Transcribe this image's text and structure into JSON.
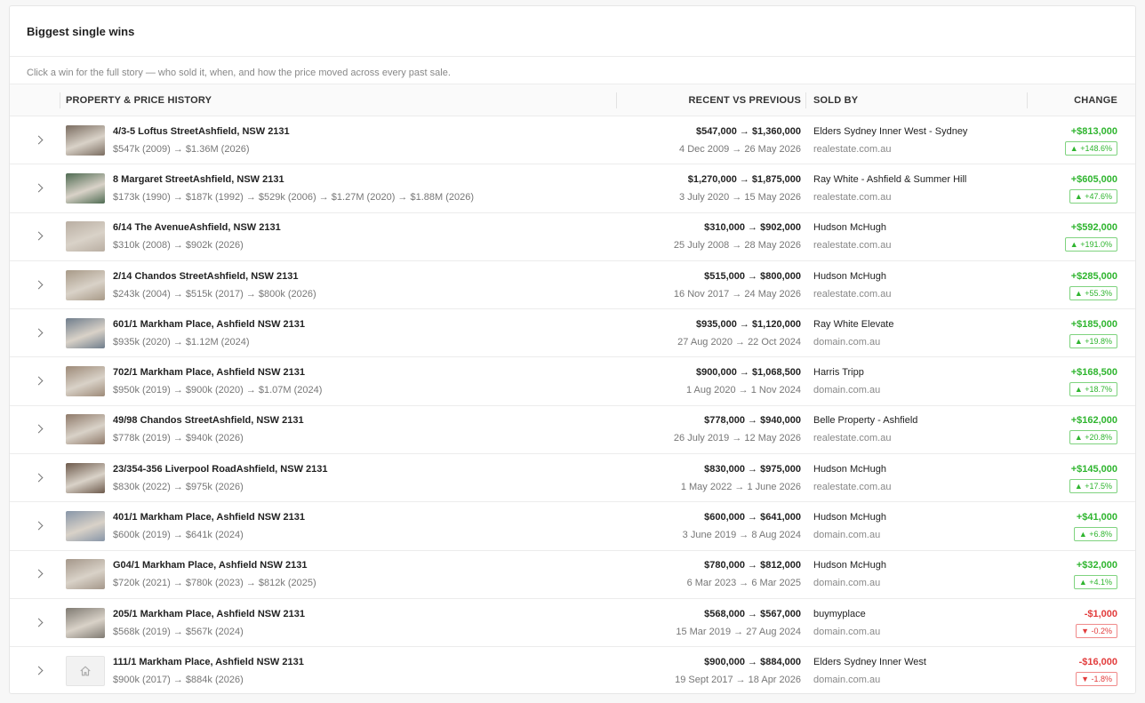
{
  "page": {
    "title": "Biggest single wins",
    "subtitle": "Click a win for the full story — who sold it, when, and how the price moved across every past sale."
  },
  "columns": {
    "property": "PROPERTY & PRICE HISTORY",
    "recent": "RECENT VS PREVIOUS",
    "sold_by": "SOLD BY",
    "change": "CHANGE"
  },
  "rows": [
    {
      "address": "4/3-5 Loftus StreetAshfield, NSW 2131",
      "history": "$547k (2009) → $1.36M (2026)",
      "prices": "$547,000 → $1,360,000",
      "dates": "4 Dec 2009 → 26 May 2026",
      "agent": "Elders Sydney Inner West - Sydney",
      "source": "realestate.com.au",
      "change": "+$813,000",
      "pct": "▲ +148.6%",
      "dir": "up",
      "thumb": "#7a6c60"
    },
    {
      "address": "8 Margaret StreetAshfield, NSW 2131",
      "history": "$173k (1990) → $187k (1992) → $529k (2006) → $1.27M (2020) → $1.88M (2026)",
      "prices": "$1,270,000 → $1,875,000",
      "dates": "3 July 2020 → 15 May 2026",
      "agent": "Ray White - Ashfield & Summer Hill",
      "source": "realestate.com.au",
      "change": "+$605,000",
      "pct": "▲ +47.6%",
      "dir": "up",
      "thumb": "#4f6b52"
    },
    {
      "address": "6/14 The AvenueAshfield, NSW 2131",
      "history": "$310k (2008) → $902k (2026)",
      "prices": "$310,000 → $902,000",
      "dates": "25 July 2008 → 28 May 2026",
      "agent": "Hudson McHugh",
      "source": "realestate.com.au",
      "change": "+$592,000",
      "pct": "▲ +191.0%",
      "dir": "up",
      "thumb": "#b9aea2"
    },
    {
      "address": "2/14 Chandos StreetAshfield, NSW 2131",
      "history": "$243k (2004) → $515k (2017) → $800k (2026)",
      "prices": "$515,000 → $800,000",
      "dates": "16 Nov 2017 → 24 May 2026",
      "agent": "Hudson McHugh",
      "source": "realestate.com.au",
      "change": "+$285,000",
      "pct": "▲ +55.3%",
      "dir": "up",
      "thumb": "#a89a88"
    },
    {
      "address": "601/1 Markham Place, Ashfield NSW 2131",
      "history": "$935k (2020) → $1.12M (2024)",
      "prices": "$935,000 → $1,120,000",
      "dates": "27 Aug 2020 → 22 Oct 2024",
      "agent": "Ray White Elevate",
      "source": "domain.com.au",
      "change": "+$185,000",
      "pct": "▲ +19.8%",
      "dir": "up",
      "thumb": "#6f7d8c"
    },
    {
      "address": "702/1 Markham Place, Ashfield NSW 2131",
      "history": "$950k (2019) → $900k (2020) → $1.07M (2024)",
      "prices": "$900,000 → $1,068,500",
      "dates": "1 Aug 2020 → 1 Nov 2024",
      "agent": "Harris Tripp",
      "source": "domain.com.au",
      "change": "+$168,500",
      "pct": "▲ +18.7%",
      "dir": "up",
      "thumb": "#9d8a78"
    },
    {
      "address": "49/98 Chandos StreetAshfield, NSW 2131",
      "history": "$778k (2019) → $940k (2026)",
      "prices": "$778,000 → $940,000",
      "dates": "26 July 2019 → 12 May 2026",
      "agent": "Belle Property - Ashfield",
      "source": "realestate.com.au",
      "change": "+$162,000",
      "pct": "▲ +20.8%",
      "dir": "up",
      "thumb": "#8f7a6a"
    },
    {
      "address": "23/354-356 Liverpool RoadAshfield, NSW 2131",
      "history": "$830k (2022) → $975k (2026)",
      "prices": "$830,000 → $975,000",
      "dates": "1 May 2022 → 1 June 2026",
      "agent": "Hudson McHugh",
      "source": "realestate.com.au",
      "change": "+$145,000",
      "pct": "▲ +17.5%",
      "dir": "up",
      "thumb": "#6d5a4c"
    },
    {
      "address": "401/1 Markham Place, Ashfield NSW 2131",
      "history": "$600k (2019) → $641k (2024)",
      "prices": "$600,000 → $641,000",
      "dates": "3 June 2019 → 8 Aug 2024",
      "agent": "Hudson McHugh",
      "source": "domain.com.au",
      "change": "+$41,000",
      "pct": "▲ +6.8%",
      "dir": "up",
      "thumb": "#8896a8"
    },
    {
      "address": "G04/1 Markham Place, Ashfield NSW 2131",
      "history": "$720k (2021) → $780k (2023) → $812k (2025)",
      "prices": "$780,000 → $812,000",
      "dates": "6 Mar 2023 → 6 Mar 2025",
      "agent": "Hudson McHugh",
      "source": "domain.com.au",
      "change": "+$32,000",
      "pct": "▲ +4.1%",
      "dir": "up",
      "thumb": "#a4978a"
    },
    {
      "address": "205/1 Markham Place, Ashfield NSW 2131",
      "history": "$568k (2019) → $567k (2024)",
      "prices": "$568,000 → $567,000",
      "dates": "15 Mar 2019 → 27 Aug 2024",
      "agent": "buymyplace",
      "source": "domain.com.au",
      "change": "-$1,000",
      "pct": "▼ -0.2%",
      "dir": "down",
      "thumb": "#7f7a72"
    },
    {
      "address": "111/1 Markham Place, Ashfield NSW 2131",
      "history": "$900k (2017) → $884k (2026)",
      "prices": "$900,000 → $884,000",
      "dates": "19 Sept 2017 → 18 Apr 2026",
      "agent": "Elders Sydney Inner West",
      "source": "domain.com.au",
      "change": "-$16,000",
      "pct": "▼ -1.8%",
      "dir": "down",
      "thumb": "",
      "thumb_icon": "home-icon"
    }
  ],
  "colors": {
    "up": "#2fb52f",
    "down": "#e23c3c"
  }
}
